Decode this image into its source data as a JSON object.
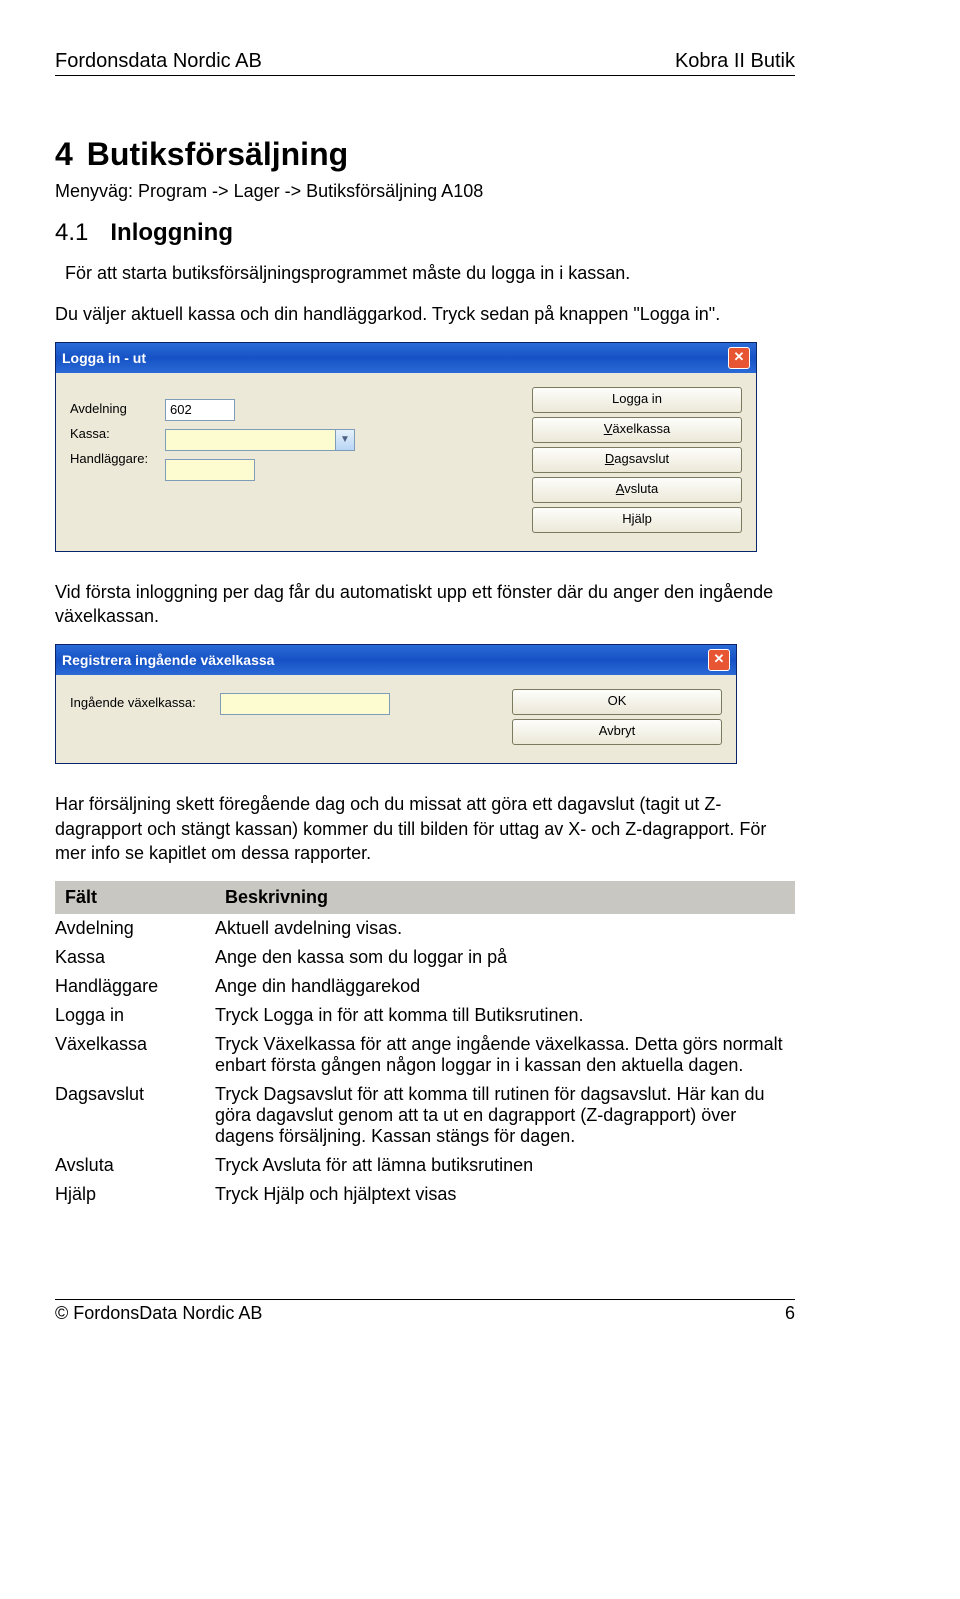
{
  "header": {
    "left": "Fordonsdata Nordic AB",
    "right": "Kobra II Butik"
  },
  "section": {
    "num": "4",
    "title": "Butiksförsäljning",
    "path": "Menyväg: Program -> Lager -> Butiksförsäljning A108",
    "sub_num": "4.1",
    "sub_title": "Inloggning",
    "p1": "För att starta butiksförsäljningsprogrammet måste du logga in i kassan.",
    "p2": "Du väljer aktuell kassa och din handläggarkod. Tryck sedan på knappen \"Logga in\".",
    "p3": "Vid första inloggning per dag får du automatiskt upp ett fönster där du anger den ingående växelkassan.",
    "p4": "Har försäljning skett föregående dag och du missat att göra ett dagavslut (tagit ut Z-dagrapport och stängt kassan) kommer du till bilden för uttag av X- och Z-dagrapport. För mer info se kapitlet om dessa rapporter."
  },
  "win1": {
    "title": "Logga in - ut",
    "labels": {
      "avd": "Avdelning",
      "kassa": "Kassa:",
      "handl": "Handläggare:"
    },
    "values": {
      "avd": "602",
      "kassa": "",
      "handl": ""
    },
    "buttons": {
      "login": "Logga in",
      "vaxel": "Växelkassa",
      "dag": "Dagsavslut",
      "avsluta": "Avsluta",
      "hjalp": "Hjälp"
    }
  },
  "win2": {
    "title": "Registrera ingående växelkassa",
    "label": "Ingående växelkassa:",
    "value": "",
    "buttons": {
      "ok": "OK",
      "avbryt": "Avbryt"
    }
  },
  "table": {
    "head": {
      "c1": "Fält",
      "c2": "Beskrivning"
    },
    "rows": [
      {
        "f": "Avdelning",
        "d": "Aktuell avdelning visas."
      },
      {
        "f": "Kassa",
        "d": "Ange den kassa som du loggar in på"
      },
      {
        "f": "Handläggare",
        "d": "Ange din handläggarekod"
      },
      {
        "f": "Logga in",
        "d": "Tryck Logga in för att komma till Butiksrutinen."
      },
      {
        "f": "Växelkassa",
        "d": "Tryck Växelkassa för att ange ingående växelkassa. Detta görs normalt enbart första gången någon loggar in i kassan den aktuella dagen."
      },
      {
        "f": "Dagsavslut",
        "d": "Tryck Dagsavslut för att komma till rutinen för dagsavslut. Här kan du göra dagavslut genom att ta ut en dagrapport (Z-dagrapport) över dagens försäljning. Kassan stängs för dagen."
      },
      {
        "f": "Avsluta",
        "d": "Tryck Avsluta för att lämna butiksrutinen"
      },
      {
        "f": "Hjälp",
        "d": "Tryck Hjälp och hjälptext visas"
      }
    ]
  },
  "footer": {
    "left": "© FordonsData Nordic AB",
    "right": "6"
  }
}
